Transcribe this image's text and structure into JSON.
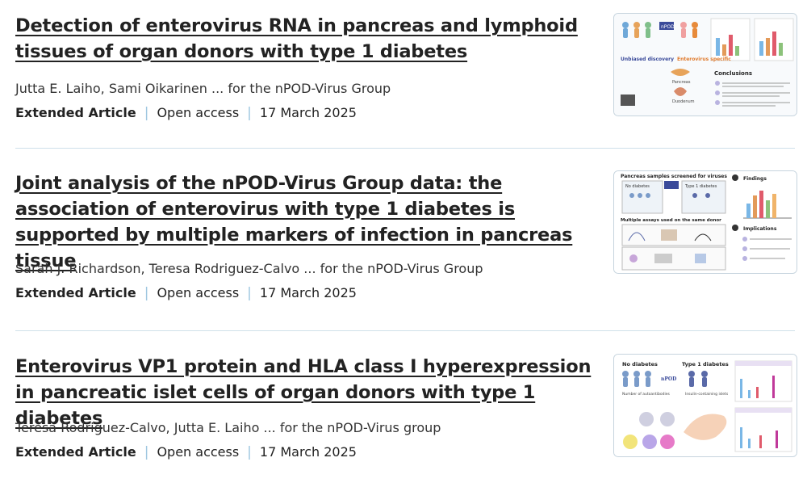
{
  "articles": [
    {
      "title": "Detection of enterovirus RNA in pancreas and lymphoid tissues of organ donors with type 1 diabetes",
      "authors": "Jutta E. Laiho, Sami Oikarinen ... for the nPOD-Virus Group",
      "type": "Extended Article",
      "access": "Open access",
      "date": "17 March 2025",
      "thumb": {
        "labels": [
          "nPOD",
          "Unbiased discovery",
          "Enterovirus specific",
          "Pancreas",
          "Duodenum",
          "Conclusions"
        ],
        "accent": "#e07b2e"
      }
    },
    {
      "title": "Joint analysis of the nPOD-Virus Group data: the association of enterovirus with type 1 diabetes is supported by multiple markers of infection in pancreas tissue",
      "authors": "Sarah J. Richardson, Teresa Rodriguez-Calvo ... for the nPOD-Virus Group",
      "type": "Extended Article",
      "access": "Open access",
      "date": "17 March 2025",
      "thumb": {
        "labels": [
          "Pancreas samples screened for viruses",
          "No diabetes",
          "Type 1 diabetes",
          "Multiple assays used on the same donor",
          "Findings",
          "Implications"
        ],
        "accent": "#3a4a9a"
      }
    },
    {
      "title": "Enterovirus VP1 protein and HLA class I hyperexpression in pancreatic islet cells of organ donors with type 1 diabetes",
      "authors": "Teresa Rodriguez-Calvo, Jutta E. Laiho ... for the nPOD-Virus group",
      "type": "Extended Article",
      "access": "Open access",
      "date": "17 March 2025",
      "thumb": {
        "labels": [
          "No diabetes",
          "Type 1 diabetes",
          "nPOD",
          "Number of autoantibodies",
          "Insulin-containing islets"
        ],
        "accent": "#c0399a"
      }
    }
  ],
  "colors": {
    "link": "#222222",
    "separator": "#9fc7e0",
    "divider": "#cfe0ea"
  }
}
